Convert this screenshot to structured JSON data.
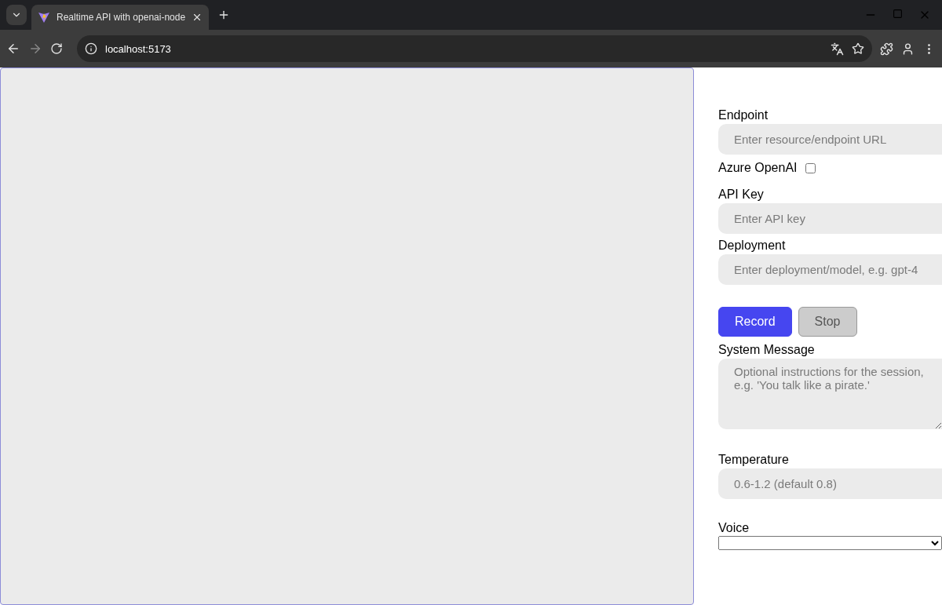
{
  "browser": {
    "tab": {
      "title": "Realtime API with openai-node",
      "selected": true
    },
    "address": "localhost:5173"
  },
  "form": {
    "items": [
      {
        "kind": "text",
        "label": "Endpoint",
        "placeholder": "Enter resource/endpoint URL"
      },
      {
        "kind": "checkbox",
        "label": "Azure OpenAI",
        "checked": false
      },
      {
        "kind": "text",
        "label": "API Key",
        "placeholder": "Enter API key"
      },
      {
        "kind": "text",
        "label": "Deployment",
        "placeholder": "Enter deployment/model, e.g. gpt-4"
      },
      {
        "kind": "buttons",
        "buttons": [
          {
            "label": "Record",
            "disabled": false
          },
          {
            "label": "Stop",
            "disabled": true
          }
        ]
      },
      {
        "kind": "textarea",
        "label": "System Message",
        "placeholder": "Optional instructions for the session, e.g. 'You talk like a pirate.'"
      },
      {
        "kind": "text",
        "label": "Temperature",
        "placeholder": "0.6-1.2 (default 0.8)"
      },
      {
        "kind": "select",
        "label": "Voice"
      }
    ]
  }
}
